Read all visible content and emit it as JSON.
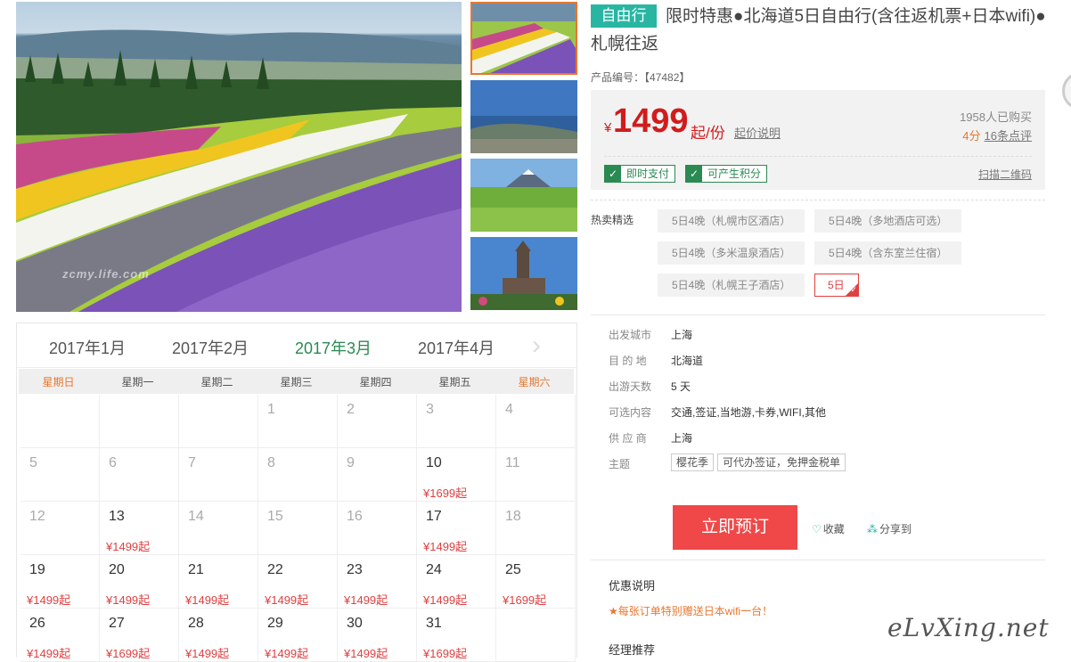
{
  "gallery": {
    "watermark": "zcmy.life.com",
    "thumbnails": [
      "flower-field-stripes",
      "harbor-city-view",
      "mount-yotei-farmland",
      "clock-tower"
    ]
  },
  "calendar": {
    "months": [
      "2017年1月",
      "2017年2月",
      "2017年3月",
      "2017年4月"
    ],
    "current_month": "2017年3月",
    "next_icon": "›",
    "weekdays": [
      "星期日",
      "星期一",
      "星期二",
      "星期三",
      "星期四",
      "星期五",
      "星期六"
    ],
    "weeks": [
      [
        {
          "d": "",
          "p": ""
        },
        {
          "d": "",
          "p": ""
        },
        {
          "d": "",
          "p": ""
        },
        {
          "d": "1",
          "p": ""
        },
        {
          "d": "2",
          "p": ""
        },
        {
          "d": "3",
          "p": ""
        },
        {
          "d": "4",
          "p": ""
        }
      ],
      [
        {
          "d": "5",
          "p": ""
        },
        {
          "d": "6",
          "p": ""
        },
        {
          "d": "7",
          "p": ""
        },
        {
          "d": "8",
          "p": ""
        },
        {
          "d": "9",
          "p": ""
        },
        {
          "d": "10",
          "p": "¥1699起"
        },
        {
          "d": "11",
          "p": ""
        }
      ],
      [
        {
          "d": "12",
          "p": ""
        },
        {
          "d": "13",
          "p": "¥1499起"
        },
        {
          "d": "14",
          "p": ""
        },
        {
          "d": "15",
          "p": ""
        },
        {
          "d": "16",
          "p": ""
        },
        {
          "d": "17",
          "p": "¥1499起"
        },
        {
          "d": "18",
          "p": ""
        }
      ],
      [
        {
          "d": "19",
          "p": "¥1499起"
        },
        {
          "d": "20",
          "p": "¥1499起"
        },
        {
          "d": "21",
          "p": "¥1499起"
        },
        {
          "d": "22",
          "p": "¥1499起"
        },
        {
          "d": "23",
          "p": "¥1499起"
        },
        {
          "d": "24",
          "p": "¥1499起"
        },
        {
          "d": "25",
          "p": "¥1699起"
        }
      ],
      [
        {
          "d": "26",
          "p": "¥1499起"
        },
        {
          "d": "27",
          "p": "¥1699起"
        },
        {
          "d": "28",
          "p": "¥1499起"
        },
        {
          "d": "29",
          "p": "¥1499起"
        },
        {
          "d": "30",
          "p": "¥1499起"
        },
        {
          "d": "31",
          "p": "¥1699起"
        },
        {
          "d": "",
          "p": ""
        }
      ]
    ]
  },
  "product": {
    "tag": "自由行",
    "title": "限时特惠●北海道5日自由行(含往返机票+日本wifi)●札幌往返",
    "id_label": "产品编号：【47482】",
    "currency": "¥",
    "price": "1499",
    "price_unit": "起/份",
    "price_note": "起价说明",
    "buyers": "1958人已购买",
    "score": "4分",
    "reviews": "16条点评",
    "badges": [
      "即时支付",
      "可产生积分"
    ],
    "scan_qr": "扫描二维码",
    "hot_label": "热卖精选",
    "options": [
      "5日4晚（札幌市区酒店）",
      "5日4晚（多地酒店可选）",
      "5日4晚（多米温泉酒店）",
      "5日4晚（含东室兰住宿）",
      "5日4晚（札幌王子酒店）",
      "5日"
    ],
    "info": [
      {
        "label": "出发城市",
        "value": "上海"
      },
      {
        "label": "目 的 地",
        "value": "北海道"
      },
      {
        "label": "出游天数",
        "value": "5 天"
      },
      {
        "label": "可选内容",
        "value": "交通,签证,当地游,卡券,WIFI,其他"
      },
      {
        "label": "供 应 商",
        "value": "上海"
      },
      {
        "label": "主题",
        "value": ""
      }
    ],
    "themes": [
      "樱花季",
      "可代办签证，免押金税单"
    ],
    "book_label": "立即预订",
    "fav_label": "收藏",
    "share_label": "分享到",
    "promo_title": "优惠说明",
    "promo_text": "★每张订单特别赠送日本wifi一台！",
    "agent_title": "经理推荐"
  },
  "site_mark": "eLvXing.net",
  "colors": {
    "accent_green": "#2a8a52",
    "price_red": "#d01c1c",
    "book_red": "#f04848",
    "teal": "#28b6a3",
    "orange": "#e8772e"
  }
}
